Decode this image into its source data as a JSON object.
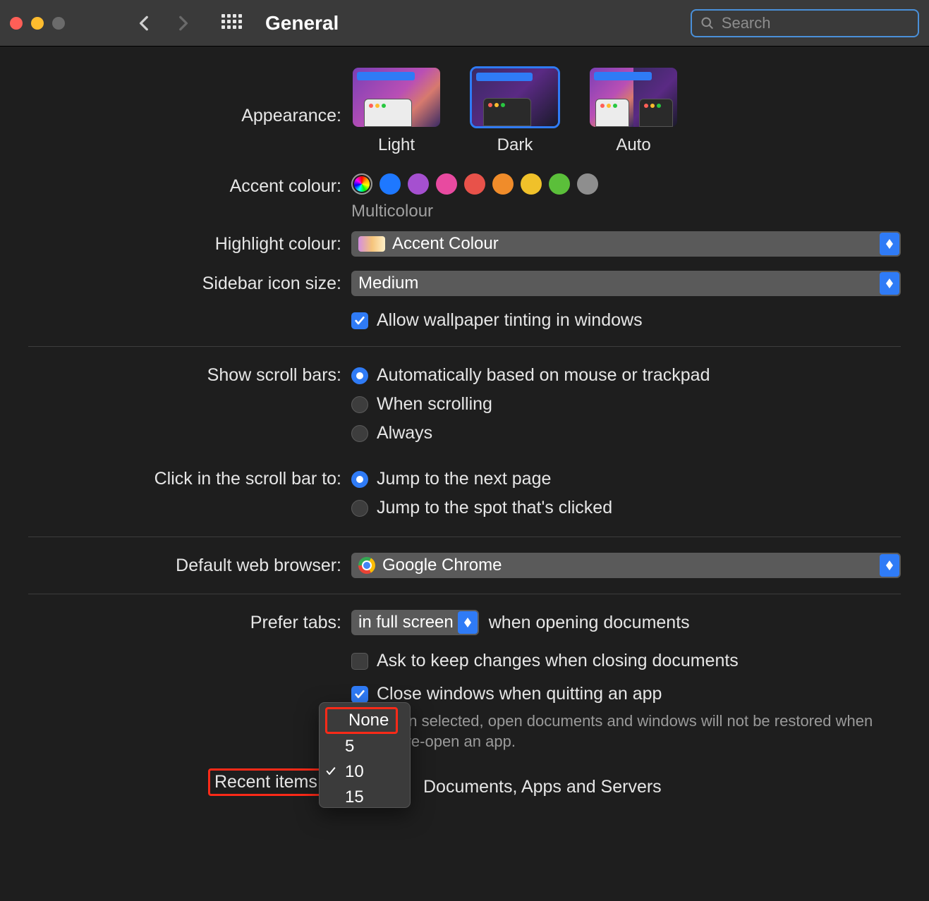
{
  "window": {
    "title": "General",
    "search_placeholder": "Search"
  },
  "appearance": {
    "label": "Appearance:",
    "options": [
      "Light",
      "Dark",
      "Auto"
    ],
    "selected": "Dark"
  },
  "accent": {
    "label": "Accent colour:",
    "colours": [
      {
        "name": "multicolour",
        "hex": "multi"
      },
      {
        "name": "blue",
        "hex": "#1e78ff"
      },
      {
        "name": "purple",
        "hex": "#a550d0"
      },
      {
        "name": "pink",
        "hex": "#e84aa0"
      },
      {
        "name": "red",
        "hex": "#e8524a"
      },
      {
        "name": "orange",
        "hex": "#f08c2a"
      },
      {
        "name": "yellow",
        "hex": "#f0c12a"
      },
      {
        "name": "green",
        "hex": "#5bbf3a"
      },
      {
        "name": "graphite",
        "hex": "#8e8e8e"
      }
    ],
    "selected": "multicolour",
    "caption": "Multicolour"
  },
  "highlight": {
    "label": "Highlight colour:",
    "value": "Accent Colour"
  },
  "sidebar_icon": {
    "label": "Sidebar icon size:",
    "value": "Medium"
  },
  "wallpaper_tint": {
    "label": "Allow wallpaper tinting in windows",
    "checked": true
  },
  "scroll_bars": {
    "label": "Show scroll bars:",
    "options": [
      "Automatically based on mouse or trackpad",
      "When scrolling",
      "Always"
    ],
    "selected": 0
  },
  "click_scroll": {
    "label": "Click in the scroll bar to:",
    "options": [
      "Jump to the next page",
      "Jump to the spot that's clicked"
    ],
    "selected": 0
  },
  "browser": {
    "label": "Default web browser:",
    "value": "Google Chrome"
  },
  "prefer_tabs": {
    "label": "Prefer tabs:",
    "value": "in full screen",
    "suffix": "when opening documents"
  },
  "ask_keep": {
    "label": "Ask to keep changes when closing documents",
    "checked": false
  },
  "close_windows": {
    "label": "Close windows when quitting an app",
    "checked": true,
    "hint": "When selected, open documents and windows will not be restored when you re-open an app."
  },
  "recent": {
    "label": "Recent items:",
    "suffix": "Documents, Apps and Servers",
    "menu": [
      "None",
      "5",
      "10",
      "15"
    ],
    "current": "10"
  }
}
